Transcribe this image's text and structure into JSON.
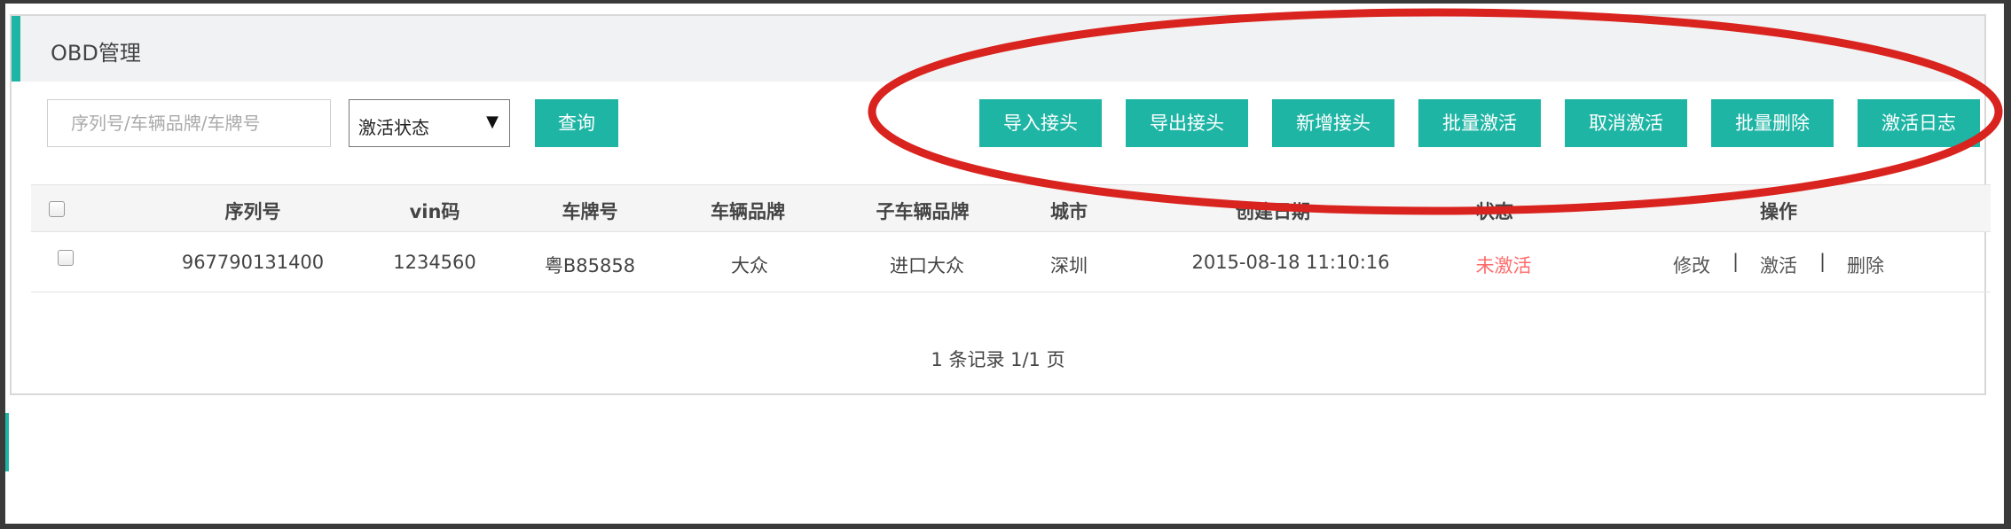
{
  "panel": {
    "title": "OBD管理"
  },
  "search": {
    "placeholder": "序列号/车辆品牌/车牌号",
    "value": ""
  },
  "filter": {
    "selected": "激活状态"
  },
  "buttons": {
    "query": "查询",
    "import": "导入接头",
    "export": "导出接头",
    "add": "新增接头",
    "batch_activate": "批量激活",
    "cancel_activate": "取消激活",
    "batch_delete": "批量删除",
    "activation_log": "激活日志"
  },
  "table": {
    "headers": [
      "序列号",
      "vin码",
      "车牌号",
      "车辆品牌",
      "子车辆品牌",
      "城市",
      "创建日期",
      "状态",
      "操作"
    ],
    "rows": [
      {
        "serial": "967790131400",
        "vin": "1234560",
        "plate": "粤B85858",
        "brand": "大众",
        "sub_brand": "进口大众",
        "city": "深圳",
        "created": "2015-08-18 11:10:16",
        "status": "未激活",
        "actions": [
          "修改",
          "激活",
          "删除"
        ]
      }
    ]
  },
  "pagination": {
    "text": "1 条记录 1/1 页"
  },
  "colors": {
    "accent": "#1fb5a5",
    "inactive_status": "#ff6a6a",
    "annotation": "#d9231e"
  },
  "icons": {
    "select_arrow": "triangle-down-icon"
  }
}
